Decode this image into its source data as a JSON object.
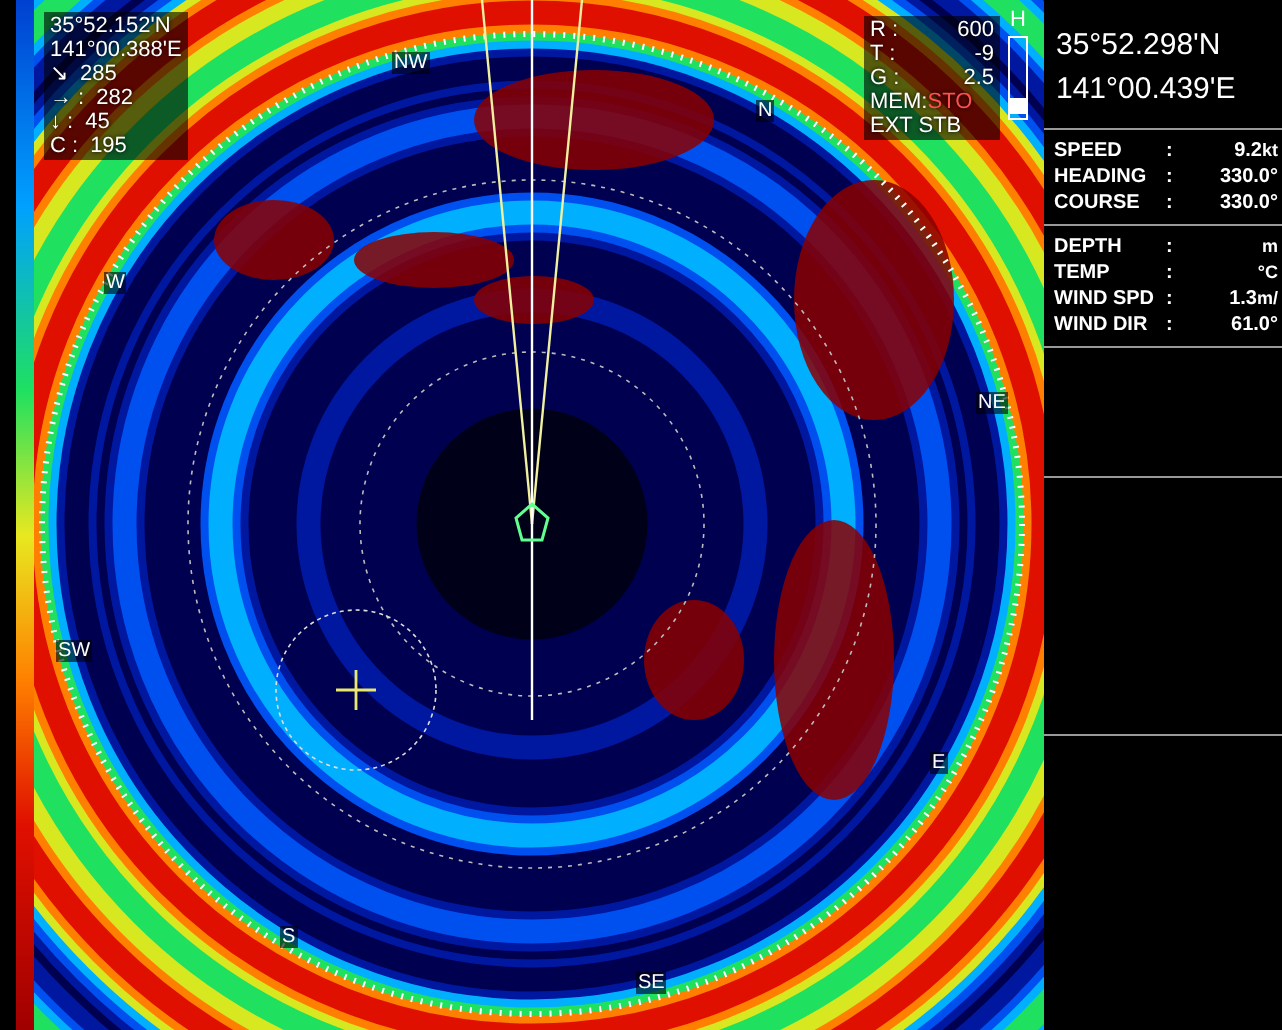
{
  "cursor_position": {
    "lat": "35°52.152'N",
    "lon": "141°00.388'E"
  },
  "target_readouts": [
    {
      "symbol": "↘",
      "value": "285"
    },
    {
      "symbol": "→ :",
      "value": "282"
    },
    {
      "symbol": "↓ :",
      "value": "45"
    },
    {
      "symbol": "C :",
      "value": "195"
    }
  ],
  "settings": [
    {
      "label": "R :",
      "value": "600"
    },
    {
      "label": "T :",
      "value": "-9"
    },
    {
      "label": "G :",
      "value": "2.5"
    }
  ],
  "memory": {
    "label": "MEM:",
    "value": "STO"
  },
  "mode": "EXT STB",
  "gain_bar": {
    "label": "H",
    "level": 0.05
  },
  "compass": [
    "NW",
    "N",
    "NE",
    "E",
    "SE",
    "S",
    "SW",
    "W"
  ],
  "panel": {
    "lat": "35°52.298'N",
    "lon": "141°00.439'E",
    "nav": [
      {
        "label": "SPEED",
        "sep": ":",
        "value": "9.2",
        "unit": "kt"
      },
      {
        "label": "HEADING",
        "sep": ":",
        "value": "330.0°"
      },
      {
        "label": "COURSE",
        "sep": ":",
        "value": "330.0°"
      }
    ],
    "environment": [
      {
        "label": "DEPTH",
        "sep": ":",
        "unit": "m"
      },
      {
        "label": "TEMP",
        "sep": ":",
        "unit": "°C"
      },
      {
        "label": "WIND SPD",
        "sep": ":",
        "value": "1.3",
        "unit": "m/"
      },
      {
        "label": "WIND DIR",
        "sep": ":",
        "value": "61.0°"
      }
    ]
  }
}
